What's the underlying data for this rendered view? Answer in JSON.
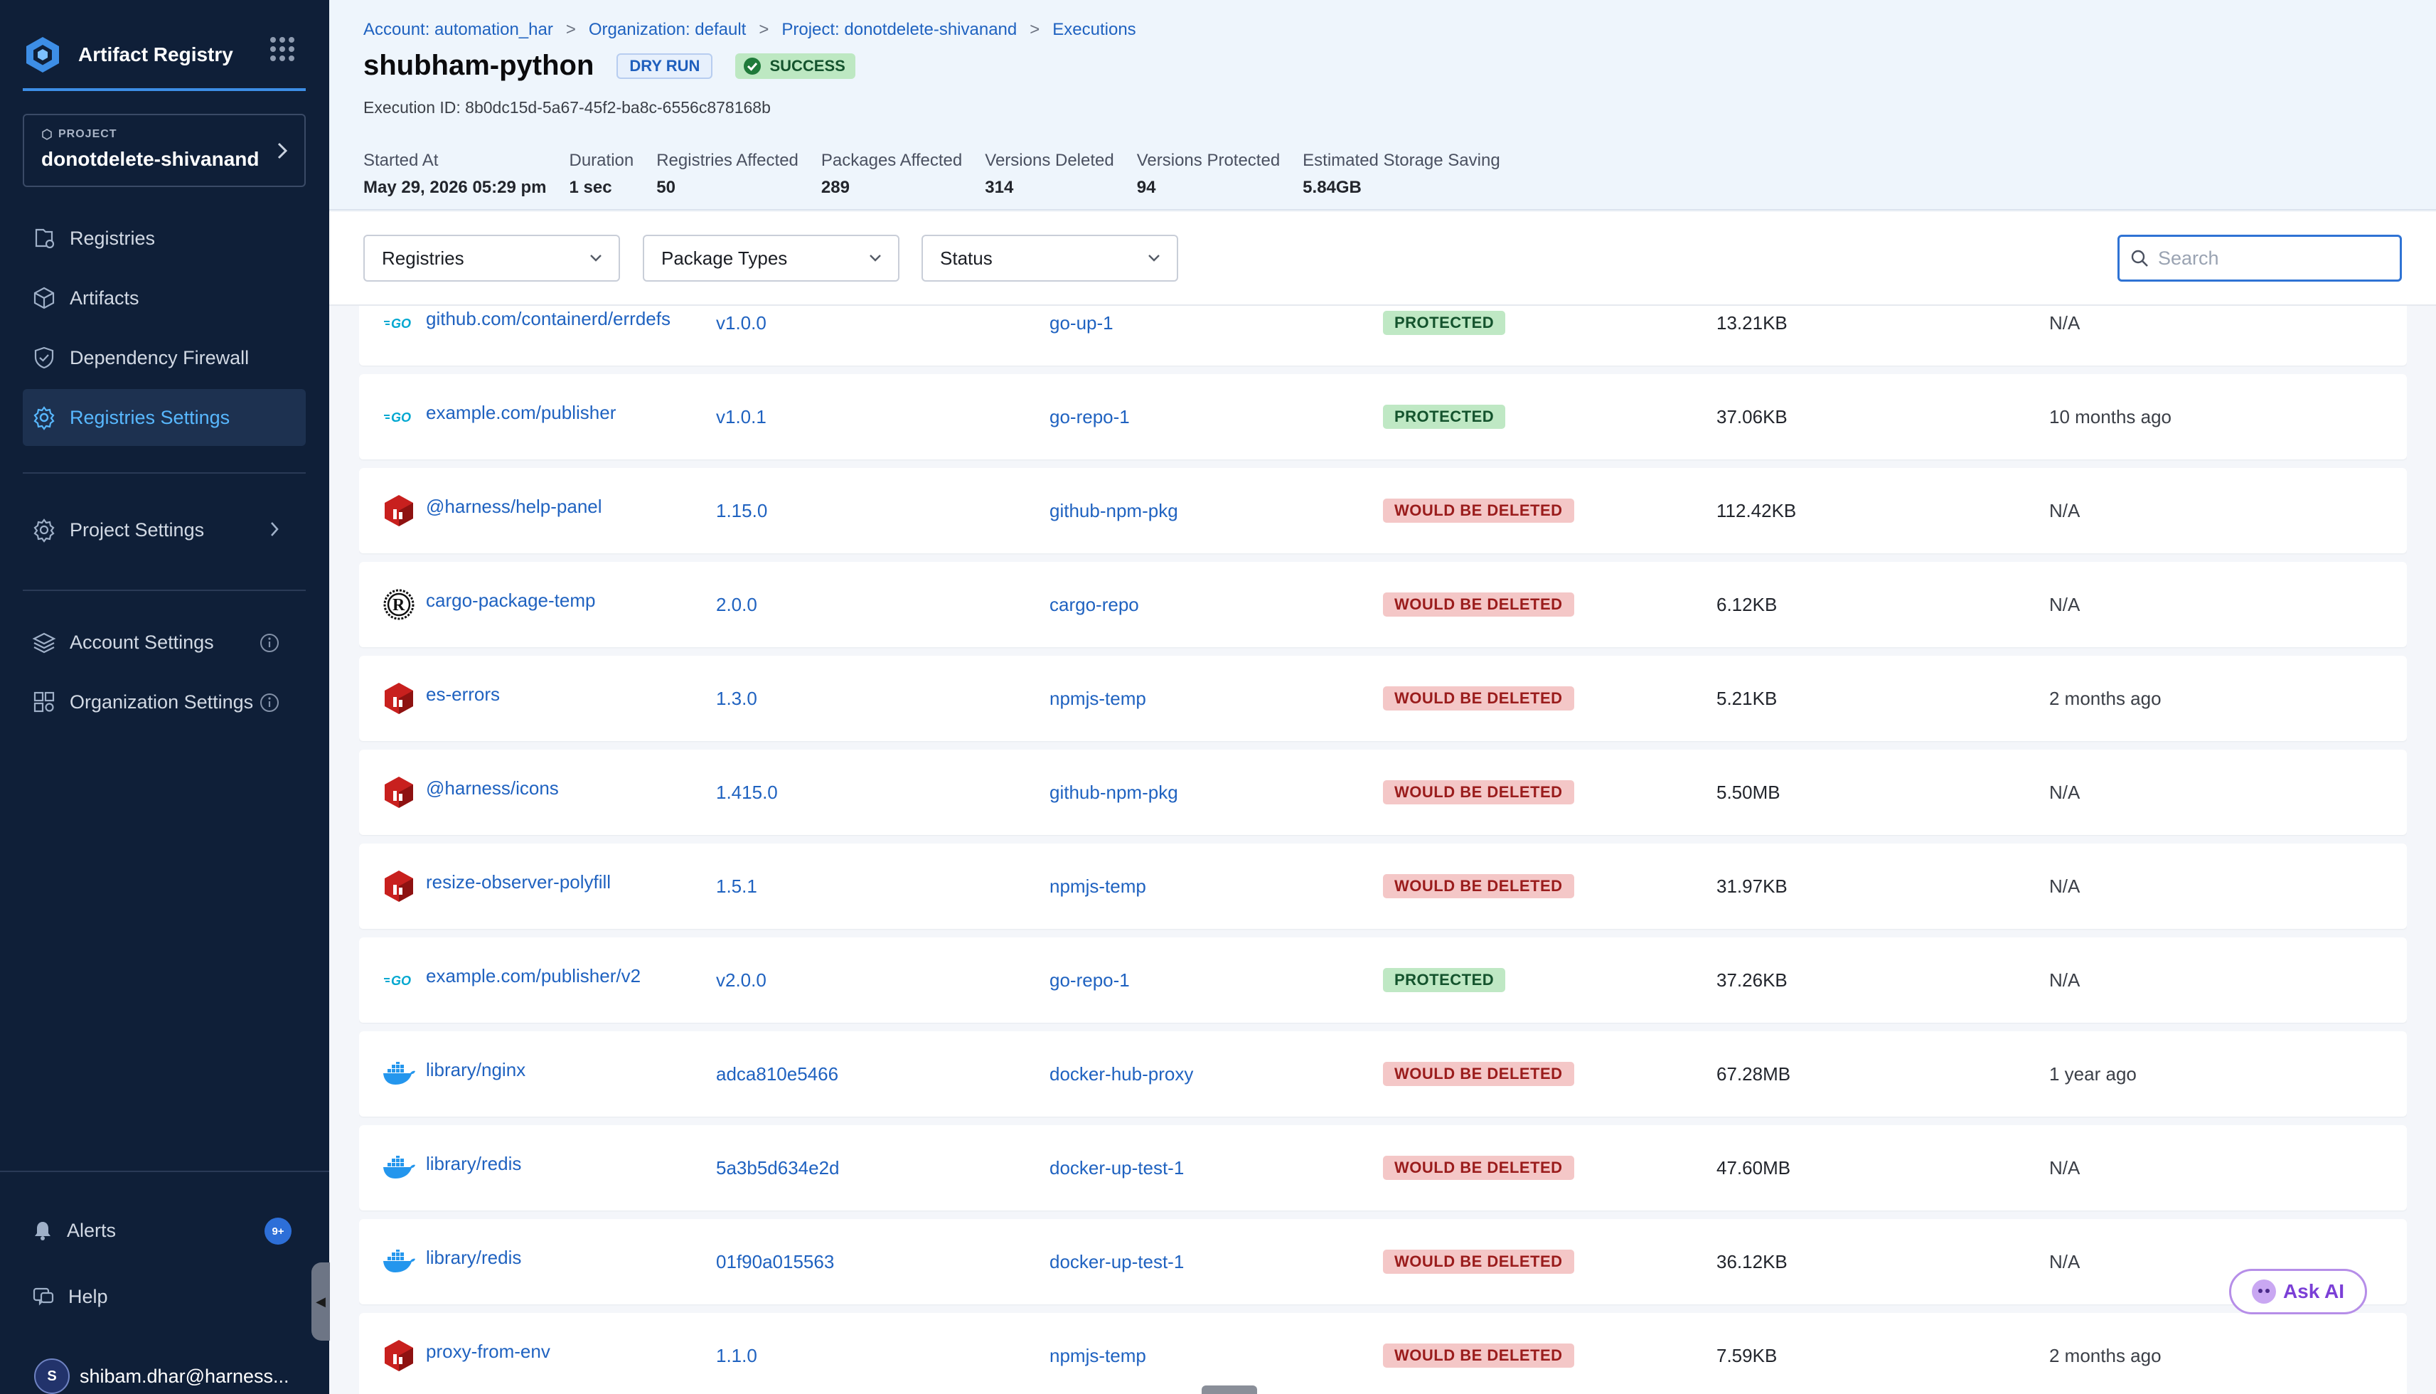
{
  "brand": {
    "title": "Artifact Registry"
  },
  "project": {
    "kicker": "PROJECT",
    "name": "donotdelete-shivanand"
  },
  "nav": {
    "registries": "Registries",
    "artifacts": "Artifacts",
    "firewall": "Dependency Firewall",
    "registries_settings": "Registries Settings",
    "project_settings": "Project Settings",
    "account_settings": "Account Settings",
    "org_settings": "Organization Settings",
    "alerts": "Alerts",
    "alerts_badge": "9+",
    "help": "Help"
  },
  "user": {
    "initial": "S",
    "email": "shibam.dhar@harness..."
  },
  "breadcrumbs": [
    "Account: automation_har",
    "Organization: default",
    "Project: donotdelete-shivanand",
    "Executions"
  ],
  "header": {
    "title": "shubham-python",
    "tag_dry_run": "DRY RUN",
    "tag_success": "SUCCESS",
    "execution_id": "Execution ID: 8b0dc15d-5a67-45f2-ba8c-6556c878168b"
  },
  "stats": [
    {
      "label": "Started At",
      "value": "May 29, 2026 05:29 pm"
    },
    {
      "label": "Duration",
      "value": "1 sec"
    },
    {
      "label": "Registries Affected",
      "value": "50"
    },
    {
      "label": "Packages Affected",
      "value": "289"
    },
    {
      "label": "Versions Deleted",
      "value": "314"
    },
    {
      "label": "Versions Protected",
      "value": "94"
    },
    {
      "label": "Estimated Storage Saving",
      "value": "5.84GB"
    }
  ],
  "filters": {
    "registries": "Registries",
    "package_types": "Package Types",
    "status": "Status",
    "search_placeholder": "Search"
  },
  "rows": [
    {
      "icon": "go",
      "name": "github.com/containerd/errdefs",
      "version": "v1.0.0",
      "registry": "go-up-1",
      "status": "PROTECTED",
      "kind": "protected",
      "size": "13.21KB",
      "downloaded": "N/A"
    },
    {
      "icon": "go",
      "name": "example.com/publisher",
      "version": "v1.0.1",
      "registry": "go-repo-1",
      "status": "PROTECTED",
      "kind": "protected",
      "size": "37.06KB",
      "downloaded": "10 months ago"
    },
    {
      "icon": "npm",
      "name": "@harness/help-panel",
      "version": "1.15.0",
      "registry": "github-npm-pkg",
      "status": "WOULD BE DELETED",
      "kind": "deleted",
      "size": "112.42KB",
      "downloaded": "N/A"
    },
    {
      "icon": "cargo",
      "name": "cargo-package-temp",
      "version": "2.0.0",
      "registry": "cargo-repo",
      "status": "WOULD BE DELETED",
      "kind": "deleted",
      "size": "6.12KB",
      "downloaded": "N/A"
    },
    {
      "icon": "npm",
      "name": "es-errors",
      "version": "1.3.0",
      "registry": "npmjs-temp",
      "status": "WOULD BE DELETED",
      "kind": "deleted",
      "size": "5.21KB",
      "downloaded": "2 months ago"
    },
    {
      "icon": "npm",
      "name": "@harness/icons",
      "version": "1.415.0",
      "registry": "github-npm-pkg",
      "status": "WOULD BE DELETED",
      "kind": "deleted",
      "size": "5.50MB",
      "downloaded": "N/A"
    },
    {
      "icon": "npm",
      "name": "resize-observer-polyfill",
      "version": "1.5.1",
      "registry": "npmjs-temp",
      "status": "WOULD BE DELETED",
      "kind": "deleted",
      "size": "31.97KB",
      "downloaded": "N/A"
    },
    {
      "icon": "go",
      "name": "example.com/publisher/v2",
      "version": "v2.0.0",
      "registry": "go-repo-1",
      "status": "PROTECTED",
      "kind": "protected",
      "size": "37.26KB",
      "downloaded": "N/A"
    },
    {
      "icon": "docker",
      "name": "library/nginx",
      "version": "adca810e5466",
      "registry": "docker-hub-proxy",
      "status": "WOULD BE DELETED",
      "kind": "deleted",
      "size": "67.28MB",
      "downloaded": "1 year ago"
    },
    {
      "icon": "docker",
      "name": "library/redis",
      "version": "5a3b5d634e2d",
      "registry": "docker-up-test-1",
      "status": "WOULD BE DELETED",
      "kind": "deleted",
      "size": "47.60MB",
      "downloaded": "N/A"
    },
    {
      "icon": "docker",
      "name": "library/redis",
      "version": "01f90a015563",
      "registry": "docker-up-test-1",
      "status": "WOULD BE DELETED",
      "kind": "deleted",
      "size": "36.12KB",
      "downloaded": "N/A"
    },
    {
      "icon": "npm",
      "name": "proxy-from-env",
      "version": "1.1.0",
      "registry": "npmjs-temp",
      "status": "WOULD BE DELETED",
      "kind": "deleted",
      "size": "7.59KB",
      "downloaded": "2 months ago"
    }
  ],
  "ask_ai": "Ask AI",
  "colors": {
    "sidebar": "#0f1f38",
    "accent": "#1f62c0",
    "protected": "#bfe8c4",
    "deleted": "#f4c7c7"
  }
}
